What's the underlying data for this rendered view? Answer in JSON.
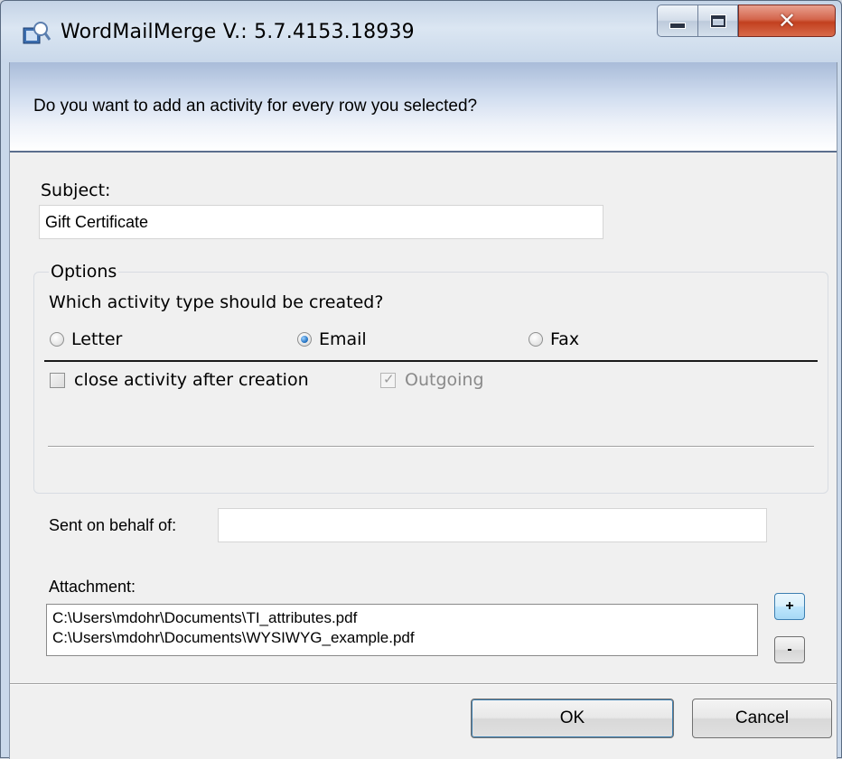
{
  "window": {
    "title": "WordMailMerge V.: 5.7.4153.18939",
    "icons": {
      "app": "mailmerge-app-icon",
      "minimize": "minimize-icon",
      "maximize": "maximize-icon",
      "close": "close-icon"
    }
  },
  "header": {
    "question": "Do you want to add an activity for every row you selected?"
  },
  "subject": {
    "label": "Subject:",
    "value": "Gift Certificate"
  },
  "options": {
    "group_title": "Options",
    "question": "Which activity type should be created?",
    "activity_types": [
      {
        "label": "Letter",
        "selected": false
      },
      {
        "label": "Email",
        "selected": true
      },
      {
        "label": "Fax",
        "selected": false
      }
    ],
    "close_after_creation": {
      "label": "close activity after creation",
      "checked": false
    },
    "outgoing": {
      "label": "Outgoing",
      "checked": true,
      "enabled": false
    }
  },
  "behalf": {
    "label": "Sent on behalf of:",
    "value": ""
  },
  "attachment": {
    "label": "Attachment:",
    "items": [
      "C:\\Users\\mdohr\\Documents\\TI_attributes.pdf",
      "C:\\Users\\mdohr\\Documents\\WYSIWYG_example.pdf"
    ],
    "add_label": "+",
    "remove_label": "-"
  },
  "buttons": {
    "ok": "OK",
    "cancel": "Cancel"
  },
  "colors": {
    "title_band": "#c4d3e6",
    "header_gradient_top": "#a9bcd9",
    "close_button": "#c2401f",
    "radio_selected": "#2a79c8"
  }
}
